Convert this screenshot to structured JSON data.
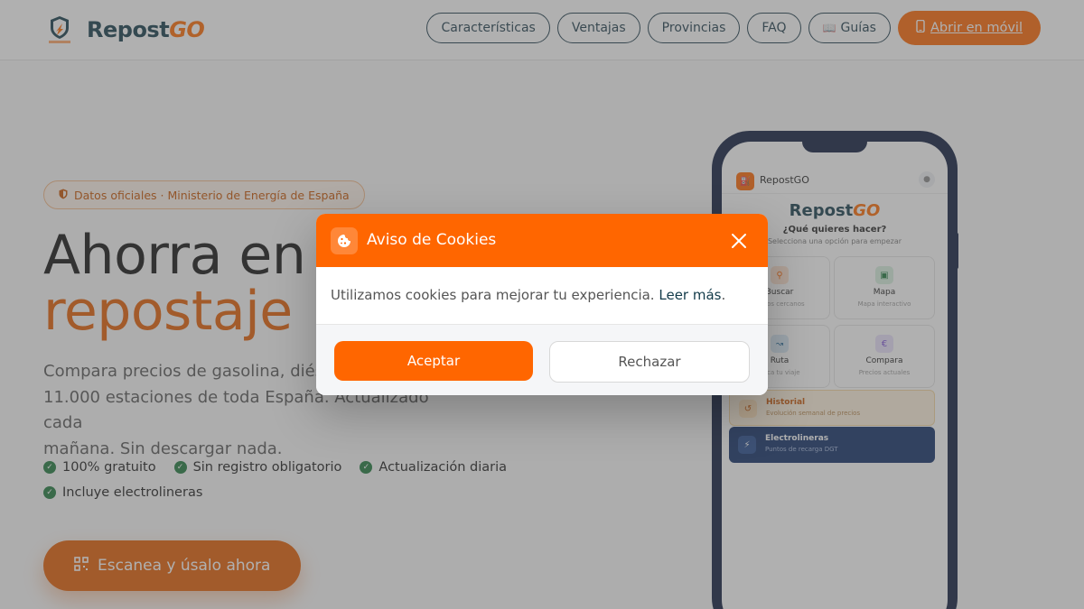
{
  "header": {
    "brand_main": "Repost",
    "brand_accent": "GO",
    "nav": [
      {
        "label": "Características"
      },
      {
        "label": "Ventajas"
      },
      {
        "label": "Provincias"
      },
      {
        "label": "FAQ"
      },
      {
        "label": "Guías",
        "icon": "book-icon"
      }
    ],
    "cta_label": "Abrir en móvil",
    "cta_icon": "mobile-icon"
  },
  "hero": {
    "badge": "Datos oficiales · Ministerio de Energía de España",
    "title_line1": "Ahorra en c",
    "title_line2": "repostaje",
    "lead": "Compara precios de gasolina, diése... 11.000 estaciones de toda España. Actualizado cada mañana. Sin descargar nada.",
    "lead_line1": "Compara precios de gasolina, diése",
    "lead_line2": "11.000 estaciones de toda España. Actualizado cada",
    "lead_line3": "mañana. Sin descargar nada.",
    "features": [
      "100% gratuito",
      "Sin registro obligatorio",
      "Actualización diaria",
      "Incluye electrolineras"
    ],
    "cta_label": "Escanea y úsalo ahora",
    "cta_icon": "qr-code-icon"
  },
  "phone": {
    "app_title": "RepostGO",
    "logo_main": "Repost",
    "logo_accent": "GO",
    "question": "¿Qué quieres hacer?",
    "subtitle": "Selecciona una opción para empezar",
    "tiles": [
      {
        "label": "Buscar",
        "sub": "...eros cercanos",
        "icon": "search-icon",
        "color": "#ff6600"
      },
      {
        "label": "Mapa",
        "sub": "Mapa interactivo",
        "icon": "map-icon",
        "color": "#1e7a3c"
      },
      {
        "label": "Ruta",
        "sub": "...ica tu viaje",
        "icon": "route-icon",
        "color": "#2a6d9c"
      },
      {
        "label": "Compara",
        "sub": "Precios actuales",
        "icon": "euro-icon",
        "color": "#7b4fd6"
      }
    ],
    "historial": {
      "label": "Historial",
      "sub": "Evolución semanal de precios",
      "icon": "history-icon"
    },
    "electro": {
      "label": "Electrolineras",
      "sub": "Puntos de recarga DGT",
      "icon": "ev-charger-icon"
    }
  },
  "cookie_modal": {
    "title": "Aviso de Cookies",
    "icon": "cookie-icon",
    "message": "Utilizamos cookies para mejorar tu experiencia.",
    "link_label": "Leer más",
    "link_suffix": ".",
    "accept_label": "Aceptar",
    "reject_label": "Rechazar"
  },
  "colors": {
    "brand_orange": "#ff6600",
    "brand_navy": "#133b4a",
    "check_green": "#1e7a3c"
  }
}
